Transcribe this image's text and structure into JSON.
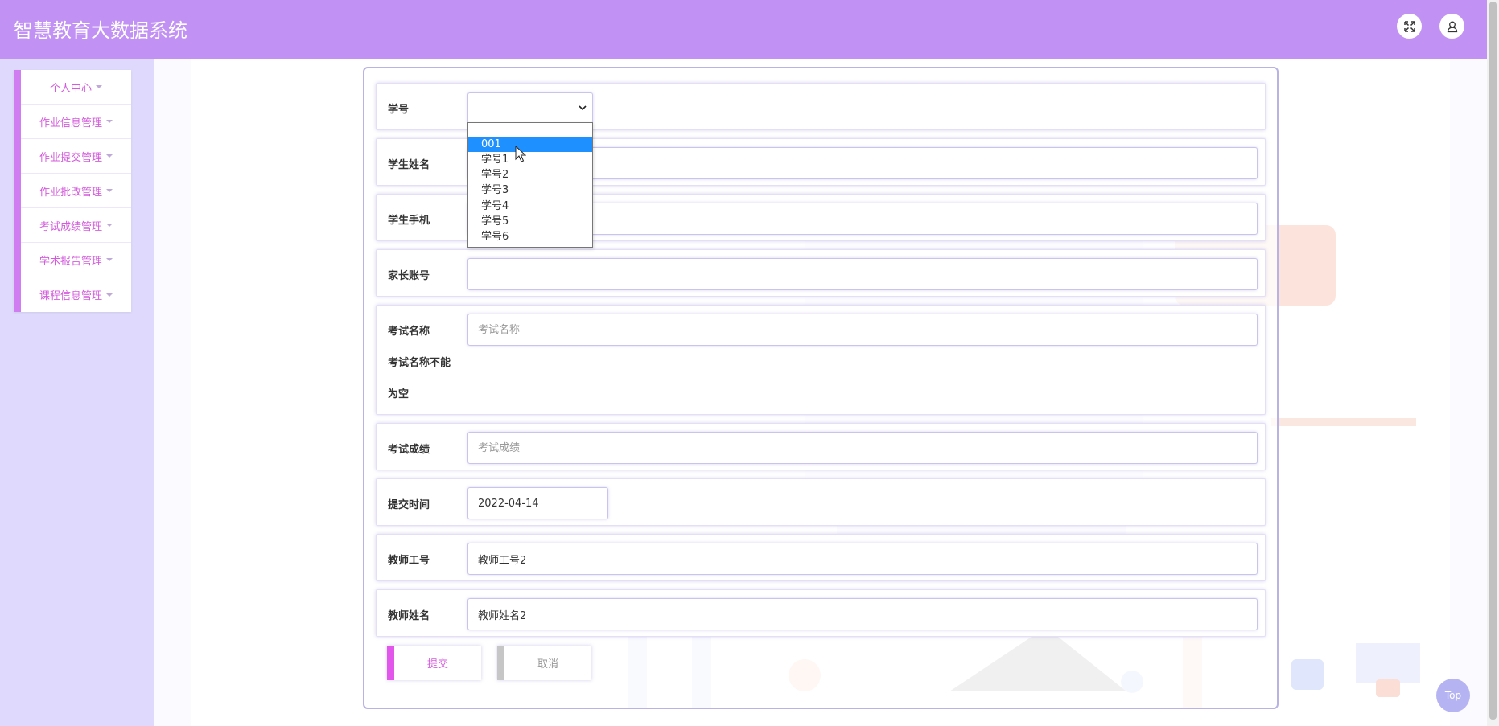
{
  "app": {
    "title": "智慧教育大数据系统"
  },
  "header": {
    "fullscreen_icon": "expand-arrows-icon",
    "user_icon": "user-icon"
  },
  "sidebar": {
    "items": [
      {
        "label": "个人中心"
      },
      {
        "label": "作业信息管理"
      },
      {
        "label": "作业提交管理"
      },
      {
        "label": "作业批改管理"
      },
      {
        "label": "考试成绩管理"
      },
      {
        "label": "学术报告管理"
      },
      {
        "label": "课程信息管理"
      }
    ]
  },
  "form": {
    "student_id": {
      "label": "学号",
      "value": "",
      "options": [
        "001",
        "学号1",
        "学号2",
        "学号3",
        "学号4",
        "学号5",
        "学号6"
      ],
      "highlighted": "001"
    },
    "student_name": {
      "label": "学生姓名",
      "value": ""
    },
    "student_phone": {
      "label": "学生手机",
      "value": ""
    },
    "parent_account": {
      "label": "家长账号",
      "value": ""
    },
    "exam_name": {
      "label": "考试名称",
      "placeholder": "考试名称",
      "value": "",
      "error_line1": "考试名称不能",
      "error_line2": "为空"
    },
    "exam_score": {
      "label": "考试成绩",
      "placeholder": "考试成绩",
      "value": ""
    },
    "submit_time": {
      "label": "提交时间",
      "value": "2022-04-14"
    },
    "teacher_id": {
      "label": "教师工号",
      "value": "教师工号2"
    },
    "teacher_name": {
      "label": "教师姓名",
      "value": "教师姓名2"
    }
  },
  "buttons": {
    "submit_label": "提交",
    "cancel_label": "取消",
    "top_label": "Top"
  },
  "colors": {
    "header": "#c192f4",
    "accent": "#d45bdc",
    "sidebar_bg": "#dfdafd",
    "dropdown_selected": "#1e90ff"
  }
}
